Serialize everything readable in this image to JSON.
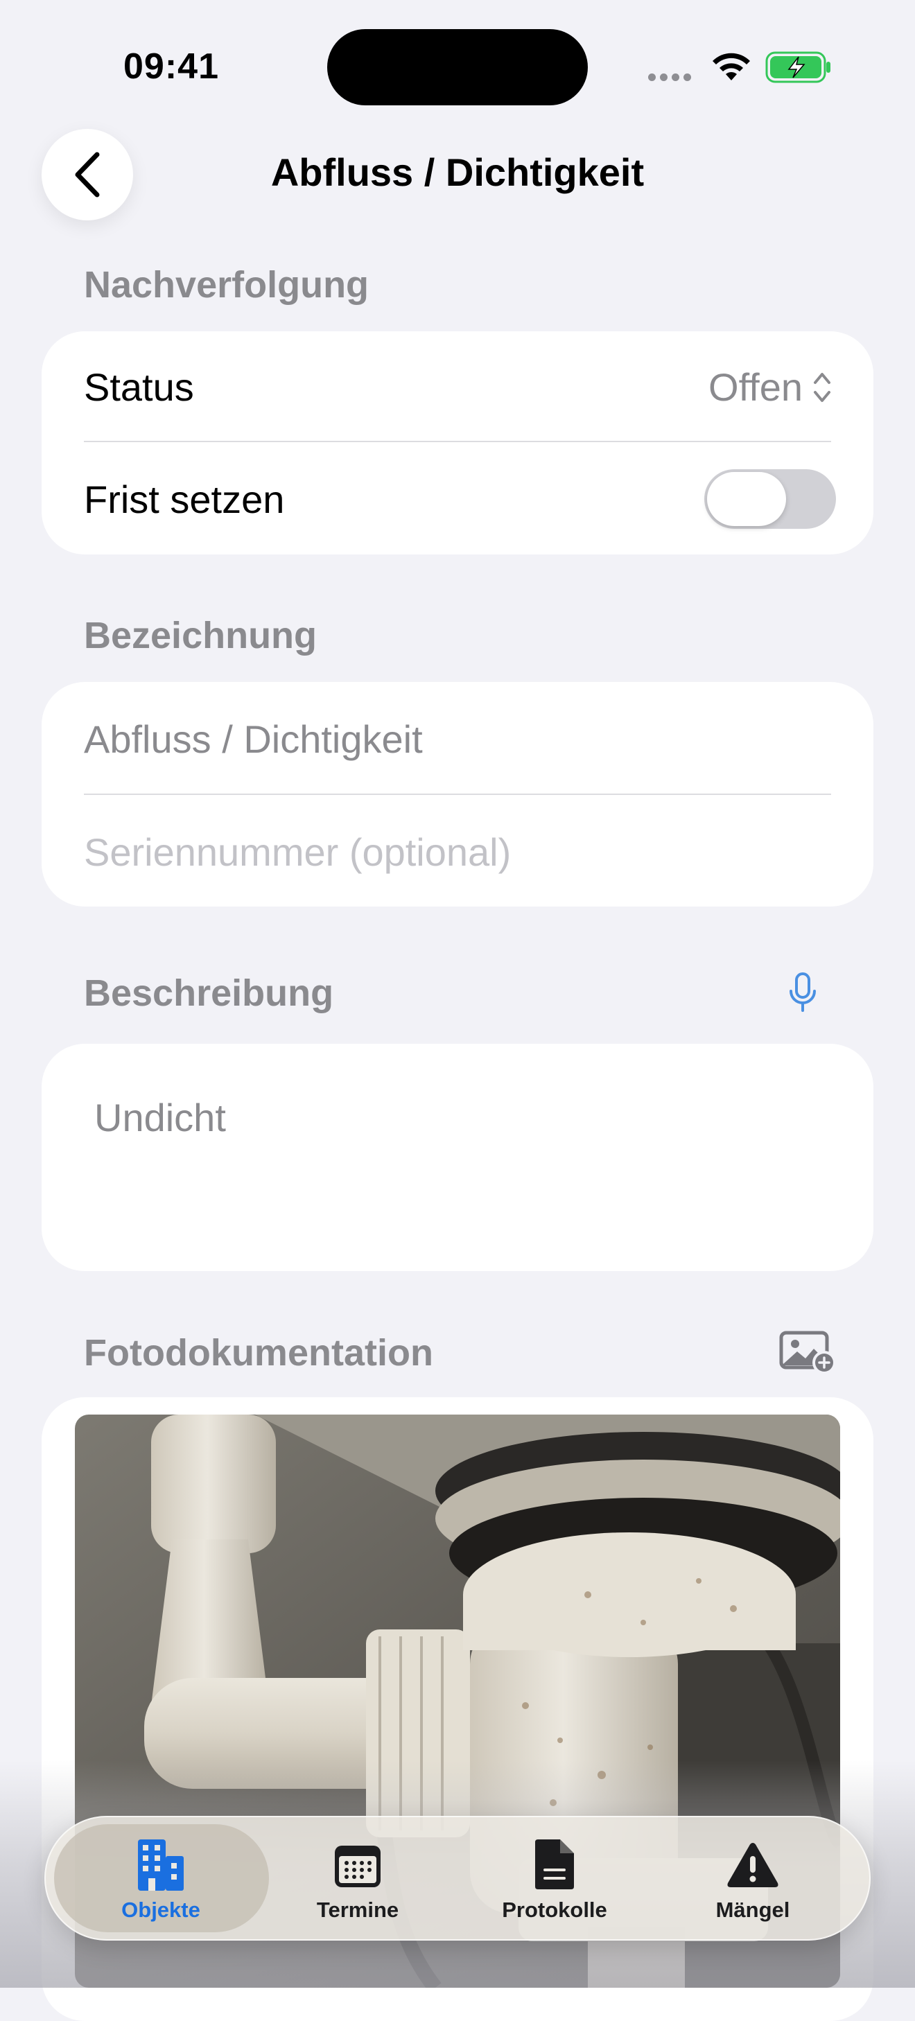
{
  "status_bar": {
    "time": "09:41"
  },
  "nav": {
    "title": "Abfluss / Dichtigkeit",
    "back_icon": "chevron-left-icon"
  },
  "tracking": {
    "header": "Nachverfolgung",
    "status_label": "Status",
    "status_value": "Offen",
    "deadline_label": "Frist setzen",
    "deadline_enabled": false
  },
  "designation": {
    "header": "Bezeichnung",
    "name_value": "Abfluss / Dichtigkeit",
    "serial_placeholder": "Seriennummer (optional)"
  },
  "description": {
    "header": "Beschreibung",
    "text": "Undicht",
    "mic_icon": "microphone-icon"
  },
  "photos": {
    "header": "Fotodokumentation",
    "add_icon": "add-photo-icon"
  },
  "tabbar": {
    "tabs": [
      {
        "label": "Objekte",
        "icon": "building-icon",
        "active": true
      },
      {
        "label": "Termine",
        "icon": "calendar-icon",
        "active": false
      },
      {
        "label": "Protokolle",
        "icon": "document-icon",
        "active": false
      },
      {
        "label": "Mängel",
        "icon": "warning-icon",
        "active": false
      }
    ]
  },
  "colors": {
    "accent": "#1a6fe0",
    "background": "#f2f2f7",
    "secondary_text": "#8a8a8e",
    "battery": "#34c759"
  }
}
